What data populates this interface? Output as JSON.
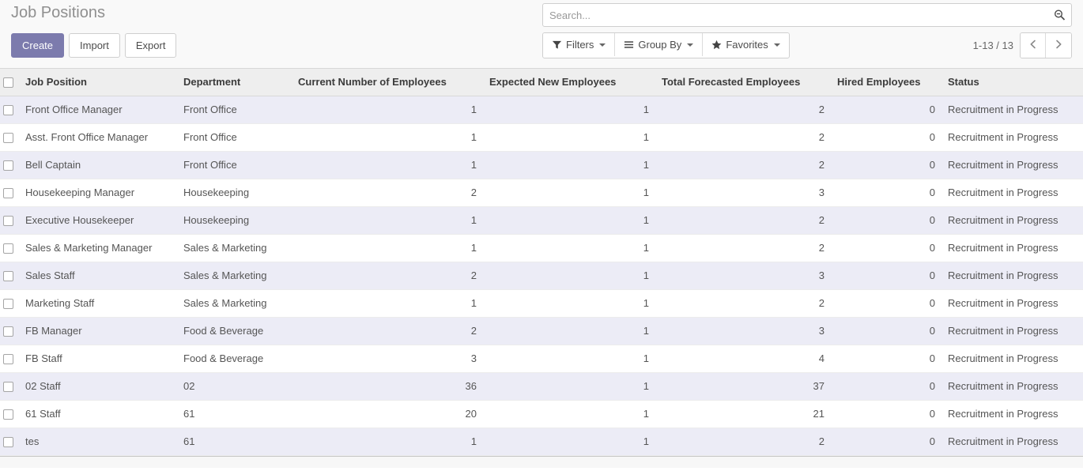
{
  "header": {
    "title": "Job Positions",
    "buttons": {
      "create": "Create",
      "import": "Import",
      "export": "Export"
    }
  },
  "search": {
    "placeholder": "Search...",
    "value": "",
    "icon": "magnifier-minus-icon"
  },
  "filter_bar": {
    "filters": {
      "label": "Filters",
      "icon": "funnel-icon"
    },
    "group_by": {
      "label": "Group By",
      "icon": "bars-icon"
    },
    "favorites": {
      "label": "Favorites",
      "icon": "star-icon"
    }
  },
  "pager": {
    "range": "1-13 / 13",
    "previous_icon": "chevron-left-icon",
    "next_icon": "chevron-right-icon"
  },
  "table": {
    "columns": [
      "Job Position",
      "Department",
      "Current Number of Employees",
      "Expected New Employees",
      "Total Forecasted Employees",
      "Hired Employees",
      "Status"
    ],
    "rows": [
      {
        "position": "Front Office Manager",
        "department": "Front Office",
        "current": "1",
        "expected": "1",
        "total": "2",
        "hired": "0",
        "status": "Recruitment in Progress"
      },
      {
        "position": "Asst. Front Office Manager",
        "department": "Front Office",
        "current": "1",
        "expected": "1",
        "total": "2",
        "hired": "0",
        "status": "Recruitment in Progress"
      },
      {
        "position": "Bell Captain",
        "department": "Front Office",
        "current": "1",
        "expected": "1",
        "total": "2",
        "hired": "0",
        "status": "Recruitment in Progress"
      },
      {
        "position": "Housekeeping Manager",
        "department": "Housekeeping",
        "current": "2",
        "expected": "1",
        "total": "3",
        "hired": "0",
        "status": "Recruitment in Progress"
      },
      {
        "position": "Executive Housekeeper",
        "department": "Housekeeping",
        "current": "1",
        "expected": "1",
        "total": "2",
        "hired": "0",
        "status": "Recruitment in Progress"
      },
      {
        "position": "Sales & Marketing Manager",
        "department": "Sales & Marketing",
        "current": "1",
        "expected": "1",
        "total": "2",
        "hired": "0",
        "status": "Recruitment in Progress"
      },
      {
        "position": "Sales Staff",
        "department": "Sales & Marketing",
        "current": "2",
        "expected": "1",
        "total": "3",
        "hired": "0",
        "status": "Recruitment in Progress"
      },
      {
        "position": "Marketing Staff",
        "department": "Sales & Marketing",
        "current": "1",
        "expected": "1",
        "total": "2",
        "hired": "0",
        "status": "Recruitment in Progress"
      },
      {
        "position": "FB Manager",
        "department": "Food & Beverage",
        "current": "2",
        "expected": "1",
        "total": "3",
        "hired": "0",
        "status": "Recruitment in Progress"
      },
      {
        "position": "FB Staff",
        "department": "Food & Beverage",
        "current": "3",
        "expected": "1",
        "total": "4",
        "hired": "0",
        "status": "Recruitment in Progress"
      },
      {
        "position": "02 Staff",
        "department": "02",
        "current": "36",
        "expected": "1",
        "total": "37",
        "hired": "0",
        "status": "Recruitment in Progress"
      },
      {
        "position": "61 Staff",
        "department": "61",
        "current": "20",
        "expected": "1",
        "total": "21",
        "hired": "0",
        "status": "Recruitment in Progress"
      },
      {
        "position": "tes",
        "department": "61",
        "current": "1",
        "expected": "1",
        "total": "2",
        "hired": "0",
        "status": "Recruitment in Progress"
      }
    ]
  },
  "colors": {
    "primary": "#7c7bad",
    "row_stripe": "#ececf6",
    "header_bg": "#eeeeee",
    "panel_bg": "#f9f9f9"
  }
}
